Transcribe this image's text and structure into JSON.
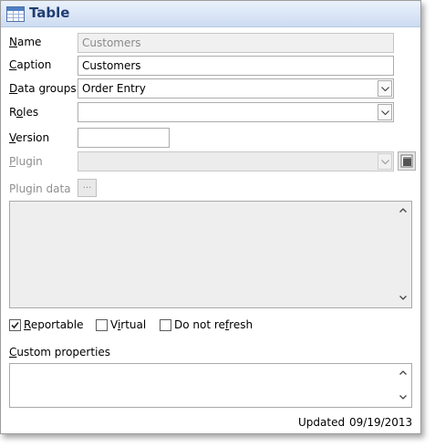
{
  "window": {
    "title": "Table",
    "icon": "table-icon"
  },
  "form": {
    "name": {
      "label_u": "N",
      "label_rest": "ame",
      "value": "Customers"
    },
    "caption": {
      "label_u": "C",
      "label_rest": "aption",
      "value": "Customers"
    },
    "data_groups": {
      "label_u": "D",
      "label_rest": "ata groups",
      "value": "Order Entry"
    },
    "roles": {
      "label_pre": "R",
      "label_u": "o",
      "label_rest": "les",
      "value": ""
    },
    "version": {
      "label_u": "V",
      "label_rest": "ersion",
      "value": ""
    },
    "plugin": {
      "label_u": "P",
      "label_rest": "lugin",
      "value": ""
    },
    "plugin_data": {
      "label": "Plugin data",
      "button_label": "..."
    },
    "plugin_data_text": ""
  },
  "options": {
    "reportable": {
      "label_u": "R",
      "label_rest": "eportable",
      "checked": true
    },
    "virtual": {
      "label_pre": "V",
      "label_u": "i",
      "label_rest": "rtual",
      "checked": false
    },
    "do_not_refresh": {
      "label_pre": "Do not re",
      "label_u": "f",
      "label_rest": "resh",
      "checked": false
    }
  },
  "custom_properties": {
    "label_u": "C",
    "label_rest": "ustom properties",
    "value": ""
  },
  "status": {
    "updated_label": "Updated",
    "updated_date": "09/19/2013"
  }
}
